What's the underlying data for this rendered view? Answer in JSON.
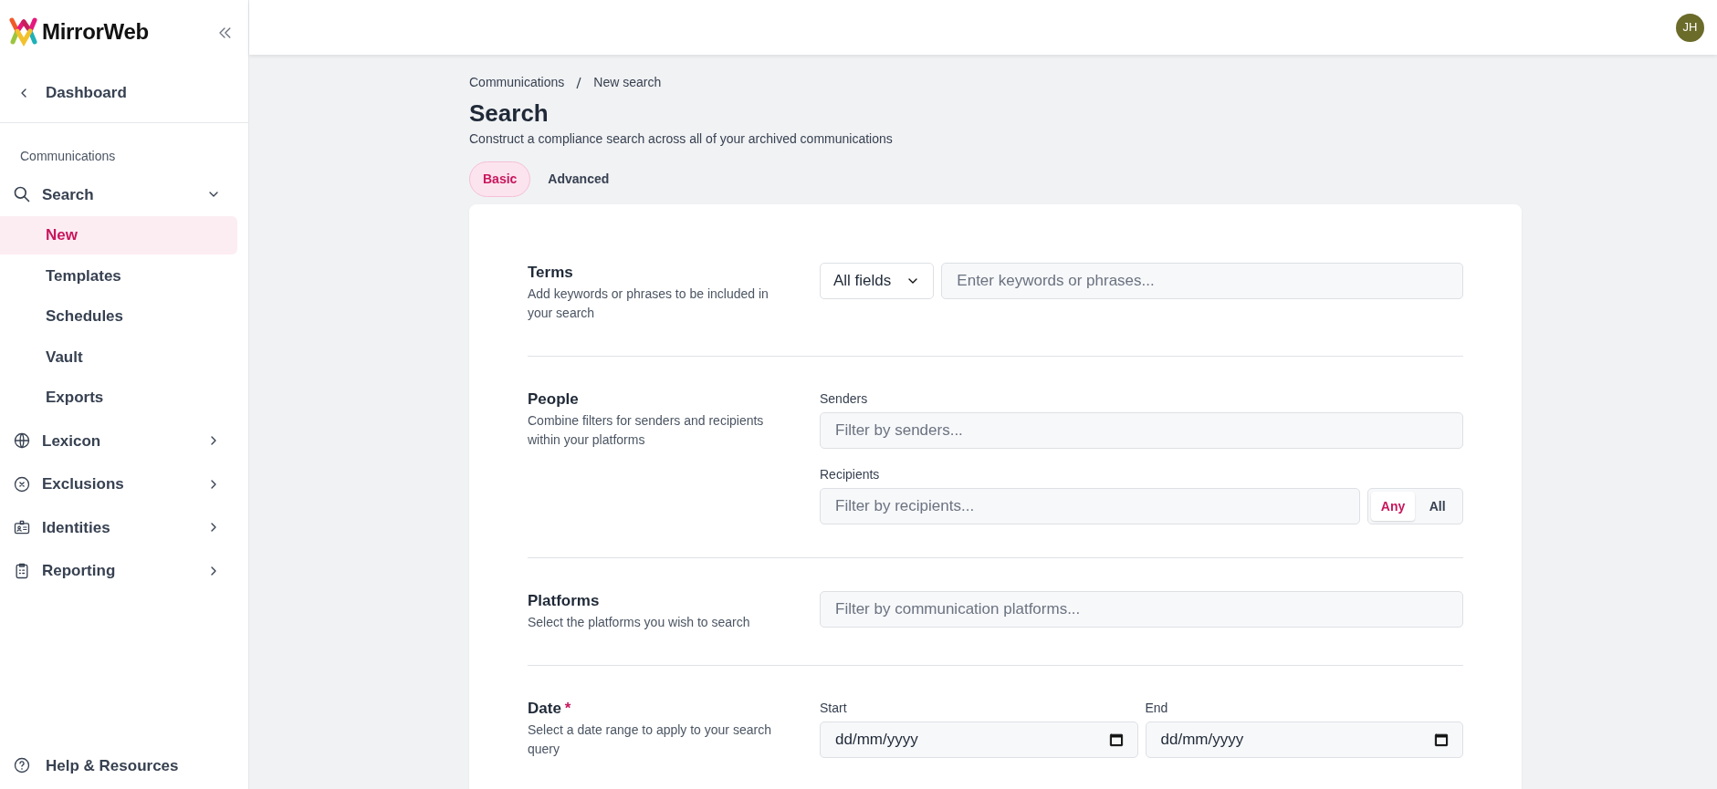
{
  "sidebar": {
    "brand": "MirrorWeb",
    "back_link": "Dashboard",
    "section": "Communications",
    "items": [
      {
        "label": "Search",
        "expanded": true,
        "children": [
          {
            "label": "New",
            "selected": true
          },
          {
            "label": "Templates",
            "selected": false
          },
          {
            "label": "Schedules",
            "selected": false
          },
          {
            "label": "Vault",
            "selected": false
          },
          {
            "label": "Exports",
            "selected": false
          }
        ]
      },
      {
        "label": "Lexicon",
        "expanded": false
      },
      {
        "label": "Exclusions",
        "expanded": false
      },
      {
        "label": "Identities",
        "expanded": false
      },
      {
        "label": "Reporting",
        "expanded": false
      }
    ],
    "help": "Help & Resources"
  },
  "header": {
    "avatar": "JH"
  },
  "breadcrumb": [
    "Communications",
    "New search"
  ],
  "title": "Search",
  "subtitle": "Construct a compliance search across all of your archived communications",
  "tabs": [
    {
      "label": "Basic",
      "selected": true
    },
    {
      "label": "Advanced",
      "selected": false
    }
  ],
  "sections": [
    {
      "kind": "terms",
      "title": "Terms",
      "description": "Add keywords or phrases to be included in your search",
      "select": {
        "value": "All fields"
      },
      "input": {
        "placeholder": "Enter keywords or phrases..."
      }
    },
    {
      "kind": "people",
      "title": "People",
      "description": "Combine filters for senders and recipients within your platforms",
      "fields": [
        {
          "label": "Senders",
          "placeholder": "Filter by senders..."
        },
        {
          "label": "Recipients",
          "placeholder": "Filter by recipients...",
          "match": [
            {
              "label": "Any",
              "selected": true
            },
            {
              "label": "All",
              "selected": false
            }
          ]
        }
      ]
    },
    {
      "kind": "platforms",
      "title": "Platforms",
      "description": "Select the platforms you wish to search",
      "input": {
        "placeholder": "Filter by communication platforms..."
      }
    },
    {
      "kind": "date",
      "title": "Date",
      "required_mark": "*",
      "description": "Select a date range to apply to your search query",
      "fields": [
        {
          "label": "Start",
          "value": "dd/mm/yyyy"
        },
        {
          "label": "End",
          "value": "dd/mm/yyyy"
        }
      ]
    }
  ]
}
